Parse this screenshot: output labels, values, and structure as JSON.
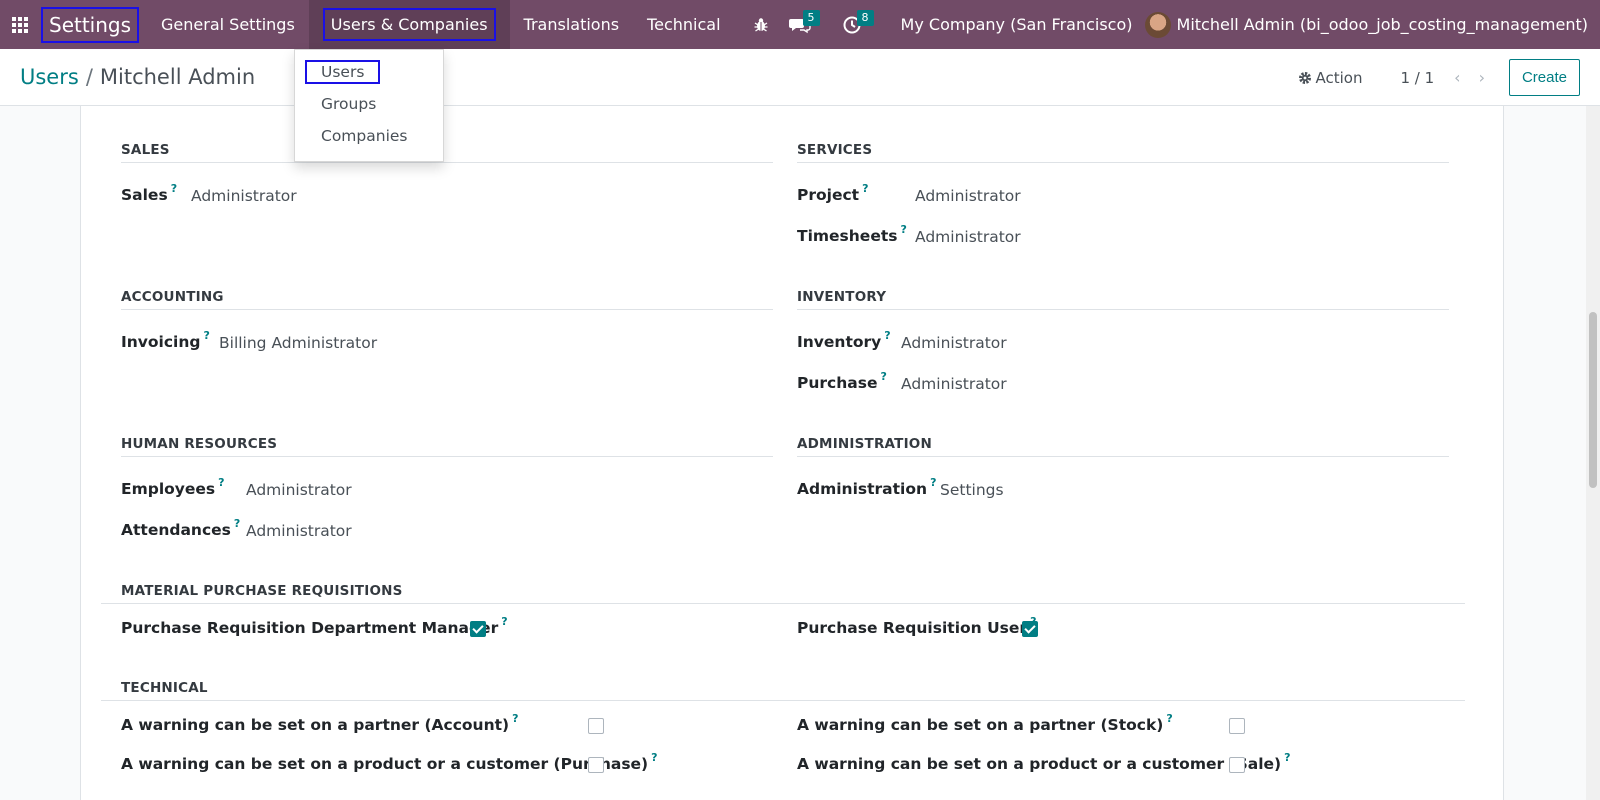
{
  "navbar": {
    "brand": "Settings",
    "menu": [
      "General Settings",
      "Users & Companies",
      "Translations",
      "Technical"
    ],
    "chat_count": "5",
    "activity_count": "8",
    "company": "My Company (San Francisco)",
    "user": "Mitchell Admin (bi_odoo_job_costing_management)"
  },
  "dropdown": {
    "items": [
      "Users",
      "Groups",
      "Companies"
    ]
  },
  "control": {
    "breadcrumb_parent": "Users",
    "breadcrumb_sep": "/",
    "breadcrumb_current": "Mitchell Admin",
    "action_label": "Action",
    "pager": "1 / 1",
    "create_label": "Create"
  },
  "sections": {
    "sales": {
      "title": "SALES",
      "fields": [
        {
          "label": "Sales",
          "value": "Administrator"
        }
      ]
    },
    "services": {
      "title": "SERVICES",
      "fields": [
        {
          "label": "Project",
          "value": "Administrator"
        },
        {
          "label": "Timesheets",
          "value": "Administrator"
        }
      ]
    },
    "accounting": {
      "title": "ACCOUNTING",
      "fields": [
        {
          "label": "Invoicing",
          "value": "Billing Administrator"
        }
      ]
    },
    "inventory": {
      "title": "INVENTORY",
      "fields": [
        {
          "label": "Inventory",
          "value": "Administrator"
        },
        {
          "label": "Purchase",
          "value": "Administrator"
        }
      ]
    },
    "hr": {
      "title": "HUMAN RESOURCES",
      "fields": [
        {
          "label": "Employees",
          "value": "Administrator"
        },
        {
          "label": "Attendances",
          "value": "Administrator"
        }
      ]
    },
    "administration": {
      "title": "ADMINISTRATION",
      "fields": [
        {
          "label": "Administration",
          "value": "Settings"
        }
      ]
    },
    "mpr": {
      "title": "MATERIAL PURCHASE REQUISITIONS",
      "fields": [
        {
          "label": "Purchase Requisition Department Manager",
          "checked": true
        },
        {
          "label": "Purchase Requisition User",
          "checked": true
        }
      ]
    },
    "technical": {
      "title": "TECHNICAL",
      "fields": [
        {
          "label": "A warning can be set on a partner (Account)",
          "checked": false
        },
        {
          "label": "A warning can be set on a partner (Stock)",
          "checked": false
        },
        {
          "label": "A warning can be set on a product or a customer (Purchase)",
          "checked": false
        },
        {
          "label": "A warning can be set on a product or a customer (Sale)",
          "checked": false
        }
      ]
    }
  },
  "help_mark": "?",
  "colors": {
    "navbar": "#714b67",
    "accent": "#017e84",
    "highlight_box": "#1a10e6"
  }
}
